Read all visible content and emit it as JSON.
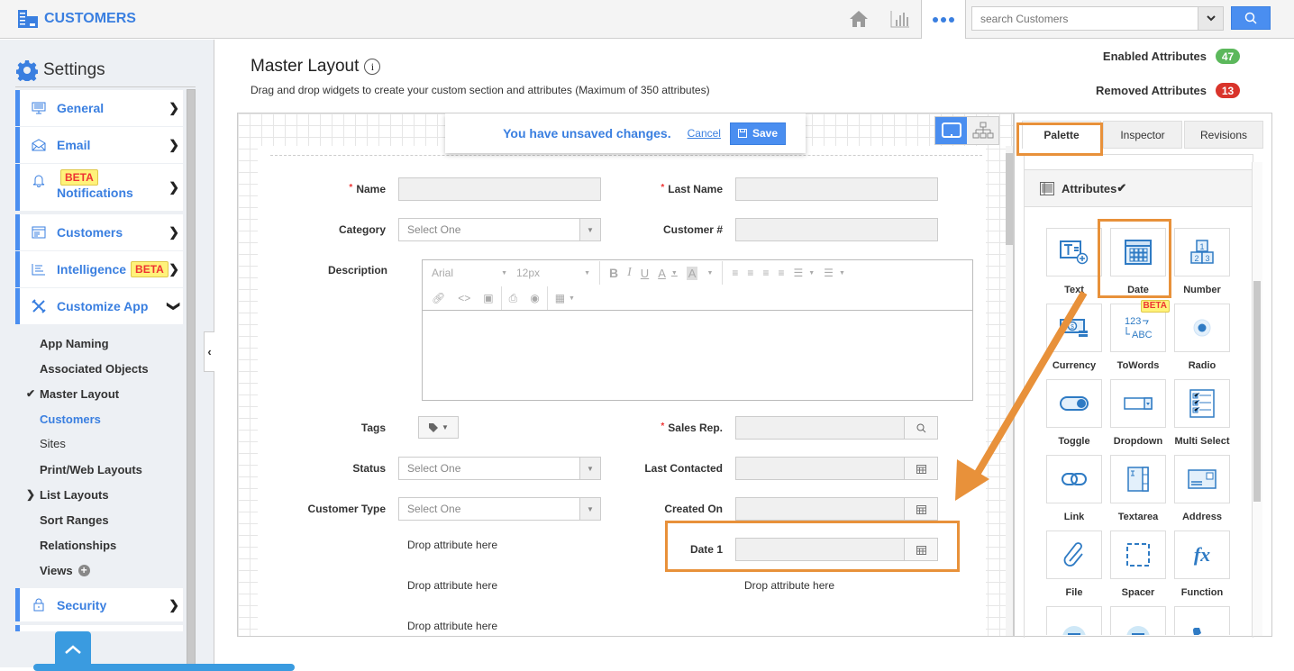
{
  "topbar": {
    "brand": "CUSTOMERS",
    "search_placeholder": "search Customers",
    "icons": [
      "home-icon",
      "analytics-icon",
      "more-icon",
      "chevron-down-icon",
      "search-icon"
    ]
  },
  "sidebar": {
    "title": "Settings",
    "items": [
      {
        "label": "General",
        "icon": "monitor-icon"
      },
      {
        "label": "Email",
        "icon": "envelope-icon"
      },
      {
        "label": "Notifications",
        "icon": "bell-icon",
        "badge": "BETA"
      },
      {
        "label": "Customers",
        "icon": "window-icon"
      },
      {
        "label": "Intelligence",
        "icon": "list-chart-icon",
        "badge": "BETA"
      },
      {
        "label": "Customize App",
        "icon": "tools-icon"
      }
    ],
    "subitems": [
      {
        "label": "App Naming"
      },
      {
        "label": "Associated Objects"
      },
      {
        "label": "Master Layout"
      },
      {
        "label": "Customers"
      },
      {
        "label": "Sites"
      },
      {
        "label": "Print/Web Layouts"
      },
      {
        "label": "List Layouts"
      },
      {
        "label": "Sort Ranges"
      },
      {
        "label": "Relationships"
      },
      {
        "label": "Views"
      }
    ],
    "security": {
      "label": "Security"
    }
  },
  "main": {
    "title": "Master Layout",
    "subtitle": "Drag and drop widgets to create your custom section and attributes (Maximum of 350 attributes)",
    "enabled_label": "Enabled Attributes",
    "enabled_count": "47",
    "removed_label": "Removed Attributes",
    "removed_count": "13",
    "colors": {
      "enabled": "#5cb85c",
      "removed": "#d9342b",
      "accent": "#4a8ef0",
      "highlight": "#e8913a"
    }
  },
  "banner": {
    "message": "You have unsaved changes.",
    "cancel": "Cancel",
    "save": "Save"
  },
  "form": {
    "name": "Name",
    "last_name": "Last Name",
    "category": "Category",
    "customer_no": "Customer #",
    "description": "Description",
    "tags": "Tags",
    "sales_rep": "Sales Rep.",
    "status": "Status",
    "last_contacted": "Last Contacted",
    "customer_type": "Customer Type",
    "created_on": "Created On",
    "date1": "Date 1",
    "select_placeholder": "Select One",
    "drop_text": "Drop attribute here",
    "rte_font": "Arial",
    "rte_size": "12px"
  },
  "panel": {
    "tabs": [
      "Palette",
      "Inspector",
      "Revisions"
    ],
    "section": "Attributes",
    "widgets": [
      {
        "label": "Text"
      },
      {
        "label": "Date"
      },
      {
        "label": "Number"
      },
      {
        "label": "Currency"
      },
      {
        "label": "ToWords",
        "badge": "BETA"
      },
      {
        "label": "Radio"
      },
      {
        "label": "Toggle"
      },
      {
        "label": "Dropdown"
      },
      {
        "label": "Multi Select"
      },
      {
        "label": "Link"
      },
      {
        "label": "Textarea"
      },
      {
        "label": "Address"
      },
      {
        "label": "File"
      },
      {
        "label": "Spacer"
      },
      {
        "label": "Function"
      }
    ]
  }
}
